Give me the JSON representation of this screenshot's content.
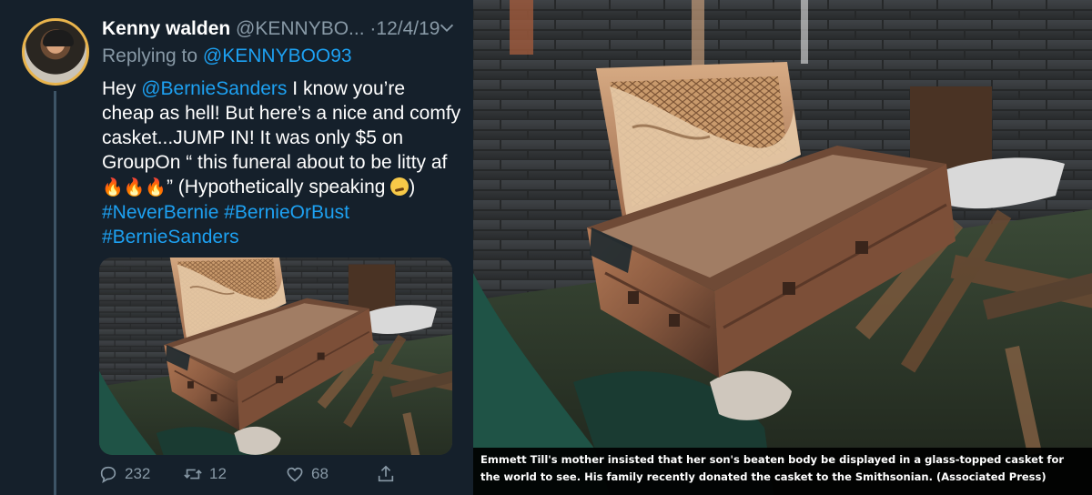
{
  "tweet": {
    "display_name": "Kenny walden",
    "handle": "@KENNYBO...",
    "separator": "·",
    "date": "12/4/19",
    "replying_to_label": "Replying to",
    "replying_to_handle": "@KENNYBOO93",
    "text": {
      "part1": "Hey ",
      "mention": "@BernieSanders",
      "part2": " I know you’re cheap as hell! But here’s a nice and comfy casket...JUMP IN! It was only $5 on GroupOn “ this funeral about to be litty af ",
      "fire_emoji": "🔥🔥🔥",
      "part3": "” (Hypothetically speaking ",
      "part4": ") ",
      "hashtag1": "#NeverBernie",
      "hashtag2": "#BernieOrBust",
      "hashtag3": "#BernieSanders"
    },
    "stats": {
      "replies": "232",
      "retweets": "12",
      "likes": "68"
    }
  },
  "article_photo": {
    "caption": "Emmett Till's mother insisted that her son's beaten body be displayed in a glass-topped casket for the world to see. His family recently donated the casket to the Smithsonian. (Associated Press)"
  },
  "colors": {
    "tweet_background": "#15202b",
    "link_blue": "#1da1f2",
    "muted_gray": "#8899a6",
    "avatar_ring": "#e9b44c"
  },
  "icons": {
    "more": "chevron-down-icon",
    "reply": "reply-icon",
    "retweet": "retweet-icon",
    "like": "heart-icon",
    "share": "share-icon"
  }
}
